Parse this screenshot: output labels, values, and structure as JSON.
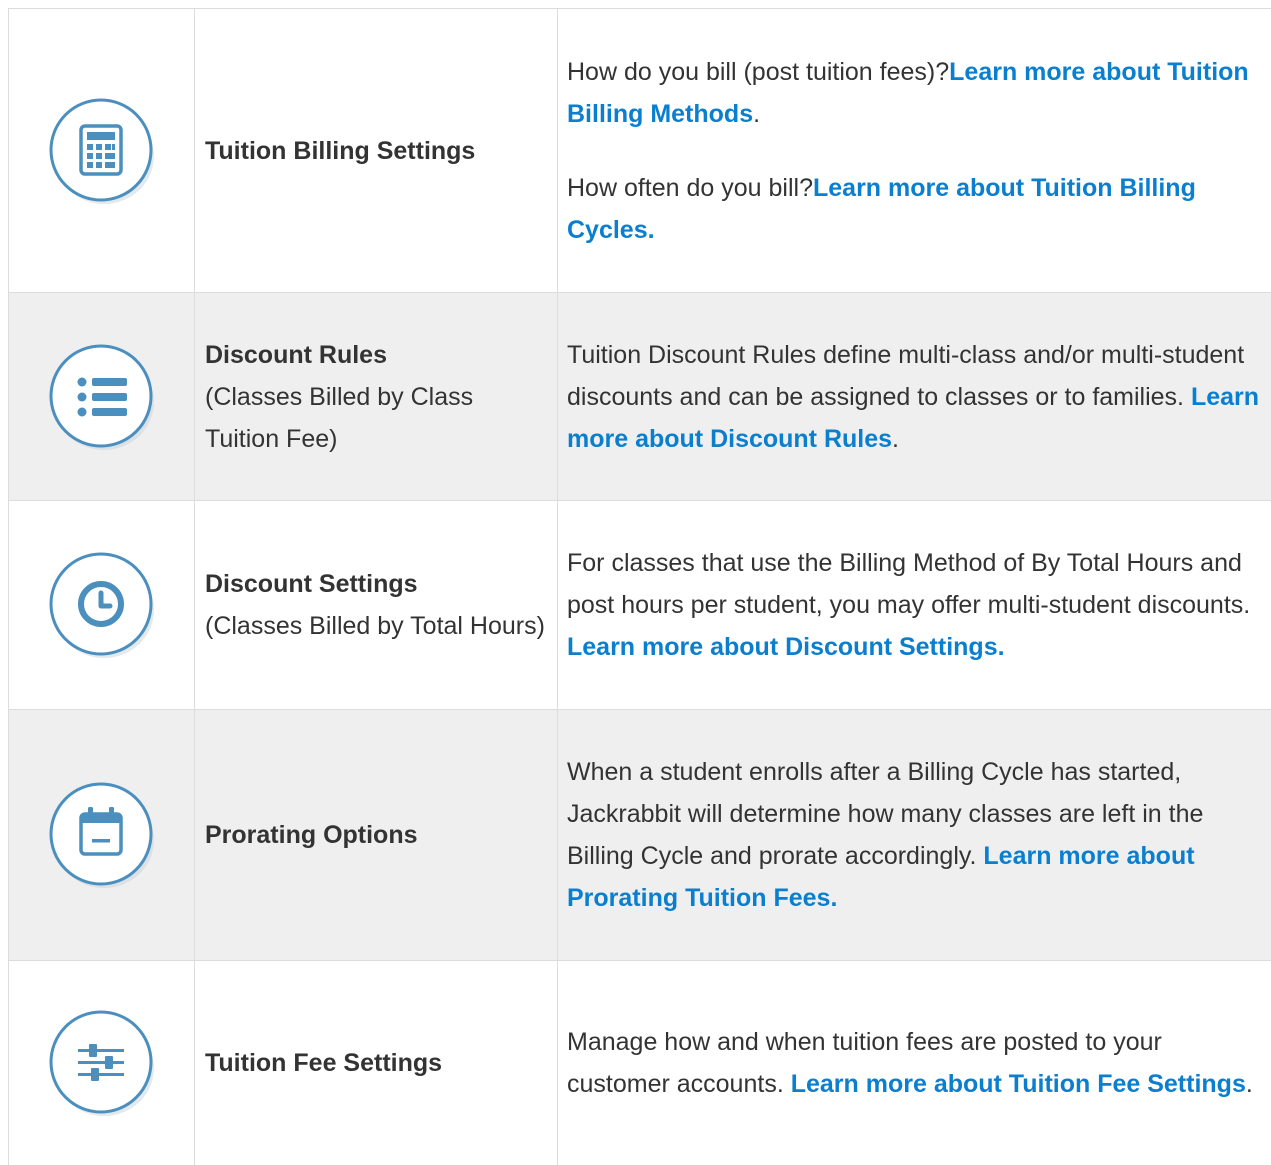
{
  "rows": [
    {
      "icon": "calculator-icon",
      "name": "Tuition Billing Settings",
      "sub": "",
      "paragraphs": [
        {
          "pre": "How do you bill (post tuition fees)?",
          "link": "Learn more about Tuition Billing Methods",
          "post": "."
        },
        {
          "pre": "How often do you bill?",
          "link": "Learn more about Tuition Billing Cycles.",
          "post": ""
        }
      ]
    },
    {
      "icon": "list-icon",
      "name": "Discount Rules",
      "sub": "(Classes Billed by Class Tuition Fee)",
      "paragraphs": [
        {
          "pre": "Tuition Discount Rules define multi-class and/or multi-student discounts and can be assigned to classes or to families. ",
          "link": "Learn more about Discount Rules",
          "post": "."
        }
      ]
    },
    {
      "icon": "clock-icon",
      "name": "Discount Settings",
      "sub": "(Classes Billed by Total Hours)",
      "paragraphs": [
        {
          "pre": "For classes that use the Billing Method of By Total Hours and post hours per student, you may offer multi-student discounts. ",
          "link": "Learn more about Discount Settings.",
          "post": ""
        }
      ]
    },
    {
      "icon": "calendar-icon",
      "name": "Prorating Options",
      "sub": "",
      "paragraphs": [
        {
          "pre": "When a student enrolls after a Billing Cycle has started, Jackrabbit will determine how many classes are left in the Billing Cycle and prorate accordingly. ",
          "link": "Learn more about Prorating Tuition Fees.",
          "post": ""
        }
      ]
    },
    {
      "icon": "sliders-icon",
      "name": "Tuition Fee Settings",
      "sub": "",
      "paragraphs": [
        {
          "pre": "Manage how and when tuition fees are posted to your customer accounts. ",
          "link": "Learn more about Tuition Fee Settings",
          "post": "."
        }
      ]
    }
  ],
  "colors": {
    "link": "#0a7fcf",
    "icon_stroke": "#4a8fbe",
    "shaded_row": "#efefef",
    "border": "#dcdcdc"
  }
}
